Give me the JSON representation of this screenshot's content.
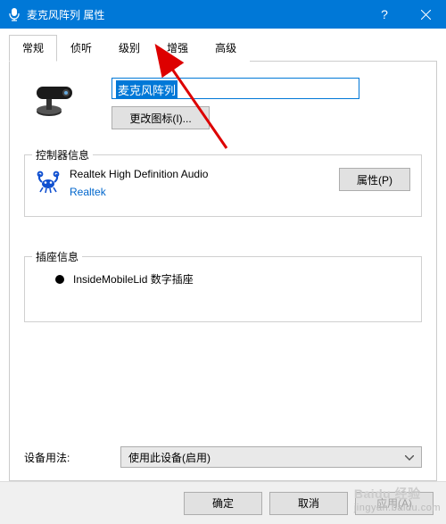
{
  "titlebar": {
    "title": "麦克风阵列 属性"
  },
  "tabs": {
    "items": [
      {
        "label": "常规"
      },
      {
        "label": "侦听"
      },
      {
        "label": "级别"
      },
      {
        "label": "增强"
      },
      {
        "label": "高级"
      }
    ]
  },
  "device": {
    "name": "麦克风阵列",
    "change_icon_label": "更改图标(I)..."
  },
  "controller": {
    "section_title": "控制器信息",
    "name": "Realtek High Definition Audio",
    "vendor": "Realtek",
    "properties_label": "属性(P)"
  },
  "jack": {
    "section_title": "插座信息",
    "name": "InsideMobileLid 数字插座"
  },
  "usage": {
    "label": "设备用法:",
    "selected": "使用此设备(启用)"
  },
  "footer": {
    "ok": "确定",
    "cancel": "取消",
    "apply": "应用(A)"
  },
  "watermark": {
    "brand": "Baidu 经验",
    "url": "jingyan.baidu.com"
  }
}
